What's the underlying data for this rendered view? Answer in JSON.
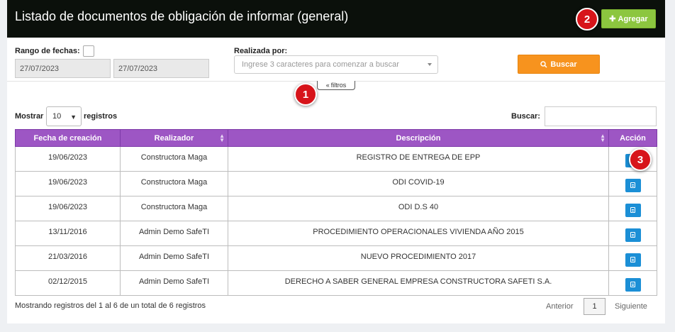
{
  "header": {
    "title": "Listado de documentos de obligación de informar (general)",
    "add_label": "Agregar"
  },
  "badges": [
    "1",
    "2",
    "3"
  ],
  "filters": {
    "range_label": "Rango de fechas:",
    "date_from": "27/07/2023",
    "date_to": "27/07/2023",
    "by_label": "Realizada por:",
    "by_placeholder": "Ingrese 3 caracteres para comenzar a buscar",
    "search_label": "Buscar",
    "toggle_label": "filtros"
  },
  "table_controls": {
    "show_label": "Mostrar",
    "length_value": "10",
    "records_label": "registros",
    "search_label": "Buscar:"
  },
  "table": {
    "columns": [
      "Fecha de creación",
      "Realizador",
      "Descripción",
      "Acción"
    ],
    "rows": [
      {
        "date": "19/06/2023",
        "author": "Constructora Maga",
        "desc": "REGISTRO DE ENTREGA DE EPP"
      },
      {
        "date": "19/06/2023",
        "author": "Constructora Maga",
        "desc": "ODI COVID-19"
      },
      {
        "date": "19/06/2023",
        "author": "Constructora Maga",
        "desc": "ODI D.S 40"
      },
      {
        "date": "13/11/2016",
        "author": "Admin Demo SafeTI",
        "desc": "PROCEDIMIENTO OPERACIONALES VIVIENDA AÑO 2015"
      },
      {
        "date": "21/03/2016",
        "author": "Admin Demo SafeTI",
        "desc": "NUEVO PROCEDIMIENTO 2017"
      },
      {
        "date": "02/12/2015",
        "author": "Admin Demo SafeTI",
        "desc": "DERECHO A SABER GENERAL EMPRESA CONSTRUCTORA SAFETI S.A."
      }
    ]
  },
  "footer": {
    "info": "Mostrando registros del 1 al 6 de un total de 6 registros",
    "prev": "Anterior",
    "page": "1",
    "next": "Siguiente"
  },
  "colors": {
    "header_bg": "#0b100b",
    "add_button": "#8cc63f",
    "search_button": "#f7931e",
    "table_header": "#9d56c4",
    "action_button": "#1b8fd6",
    "badge": "#d7141a"
  }
}
